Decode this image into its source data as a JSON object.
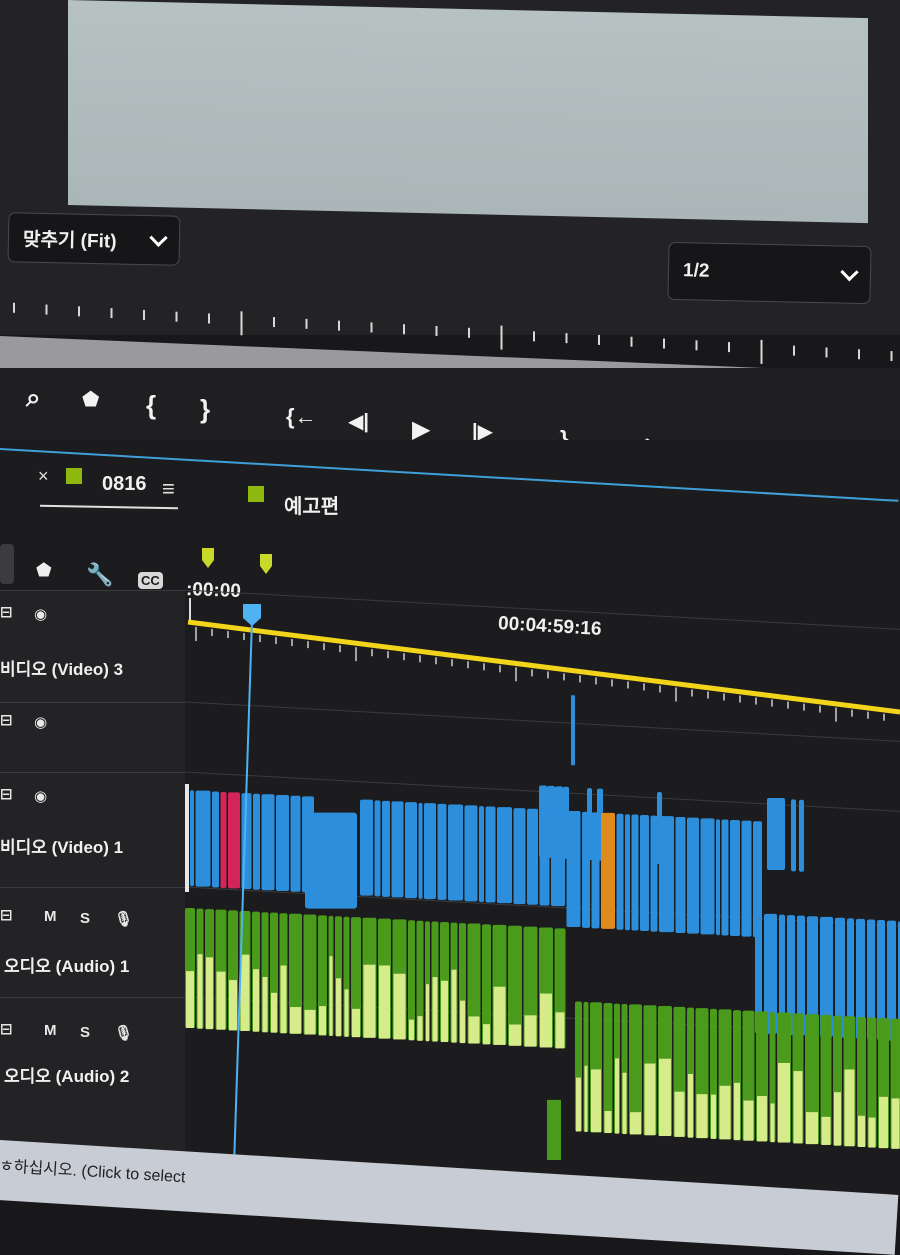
{
  "program_monitor": {
    "zoom_label": "맞추기 (Fit)",
    "resolution_label": "1/2"
  },
  "transport": {
    "buttons": [
      {
        "name": "export-frame-zoom-icon",
        "glyph": "⌕"
      },
      {
        "name": "add-marker-icon",
        "glyph": "⬟"
      },
      {
        "name": "mark-in-icon",
        "glyph": "{"
      },
      {
        "name": "mark-out-icon",
        "glyph": "}"
      },
      {
        "name": "go-to-in-icon",
        "glyph": "{←"
      },
      {
        "name": "step-back-icon",
        "glyph": "◀|"
      },
      {
        "name": "play-icon",
        "glyph": "▶"
      },
      {
        "name": "step-forward-icon",
        "glyph": "|▶"
      },
      {
        "name": "go-to-out-icon",
        "glyph": "→}"
      },
      {
        "name": "lift-icon",
        "glyph": "⏏"
      },
      {
        "name": "extract-icon",
        "glyph": "⏏"
      },
      {
        "name": "export-frame-icon",
        "glyph": "📷"
      },
      {
        "name": "comparison-view-icon",
        "glyph": "▦"
      }
    ]
  },
  "timeline": {
    "tabs": [
      {
        "close": "×",
        "label": "0816",
        "menu": "≡",
        "color": "#8fb80f"
      },
      {
        "label": "예고편",
        "color": "#8fb80f"
      }
    ],
    "timecode_start": ":00:00",
    "timecode_mid": "00:04:59:16",
    "tools": [
      {
        "name": "marker-tool-icon",
        "glyph": "⬟"
      },
      {
        "name": "wrench-icon",
        "glyph": "🔧"
      },
      {
        "name": "captions-icon",
        "glyph": "CC"
      }
    ],
    "tracks": [
      {
        "id": "v3",
        "label": "비디오 (Video) 3",
        "lock_icon": "⊟",
        "eye_icon": "◉"
      },
      {
        "id": "v2",
        "label": "",
        "lock_icon": "⊟",
        "eye_icon": "◉"
      },
      {
        "id": "v1",
        "label": "비디오 (Video) 1",
        "lock_icon": "⊟",
        "eye_icon": "◉"
      },
      {
        "id": "a1",
        "label": "오디오 (Audio) 1",
        "lock_icon": "⊟",
        "m": "M",
        "s": "S",
        "mic_icon": "🎙"
      },
      {
        "id": "a2",
        "label": "오디오 (Audio) 2",
        "lock_icon": "⊟",
        "m": "M",
        "s": "S",
        "mic_icon": "🎙"
      }
    ],
    "colors": {
      "video_clip": "#2d8fdc",
      "audio_clip": "#4a9a1c",
      "waveform": "#d6ec8a",
      "work_area": "#f2d41a",
      "playhead": "#4fb2f2",
      "red_clip": "#d5245a",
      "orange_clip": "#e08a1e",
      "marker": "#c8d92a"
    }
  },
  "status_bar": {
    "text": "ㅎ하십시오. (Click to select"
  }
}
